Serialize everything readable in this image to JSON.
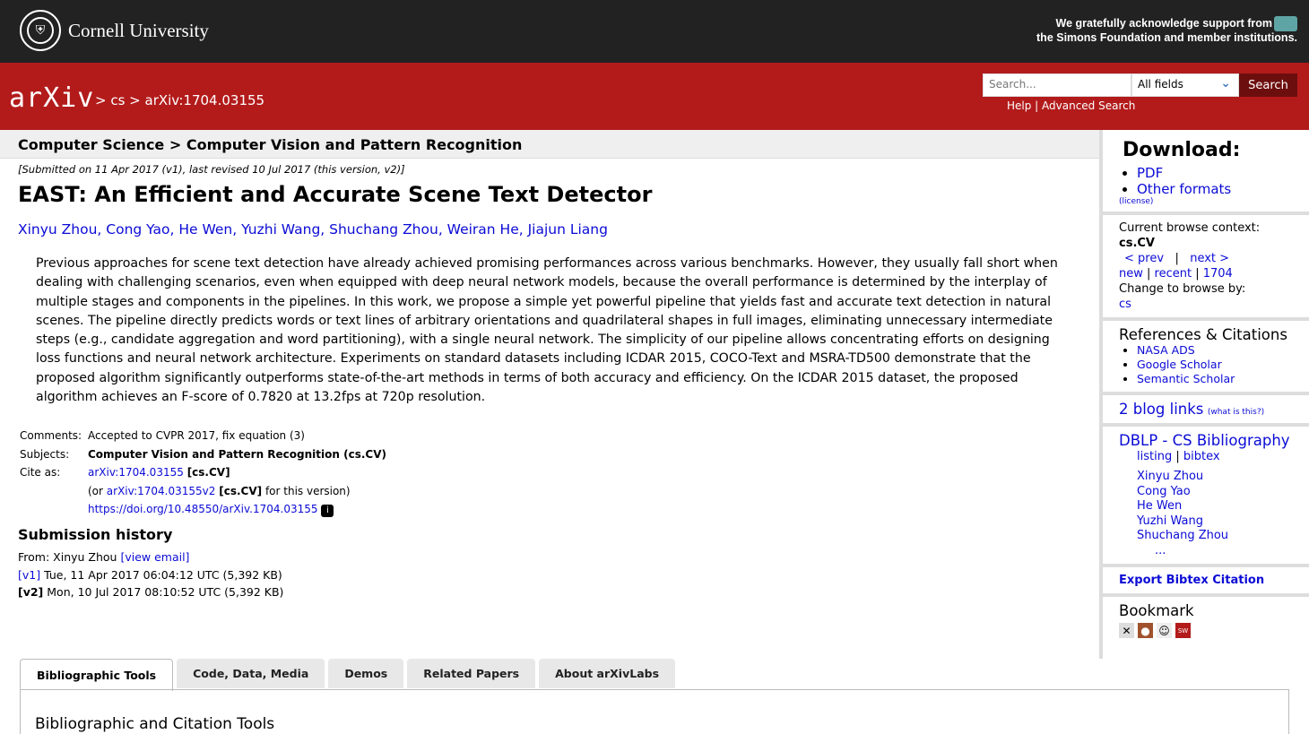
{
  "topbar": {
    "university": "Cornell University",
    "ack_line1": "We gratefully acknowledge support from",
    "ack_line2": "the Simons Foundation and member institutions."
  },
  "header": {
    "logo": "arXiv",
    "breadcrumb": "> cs > arXiv:1704.03155",
    "search_placeholder": "Search...",
    "search_field": "All fields",
    "search_button": "Search",
    "help_links": "Help | Advanced Search"
  },
  "subject_bar": "Computer Science > Computer Vision and Pattern Recognition",
  "paper": {
    "dateline": "[Submitted on 11 Apr 2017 (v1), last revised 10 Jul 2017 (this version, v2)]",
    "title": "EAST: An Efficient and Accurate Scene Text Detector",
    "authors": "Xinyu Zhou, Cong Yao, He Wen, Yuzhi Wang, Shuchang Zhou, Weiran He, Jiajun Liang",
    "abstract": "Previous approaches for scene text detection have already achieved promising performances across various benchmarks. However, they usually fall short when dealing with challenging scenarios, even when equipped with deep neural network models, because the overall performance is determined by the interplay of multiple stages and components in the pipelines. In this work, we propose a simple yet powerful pipeline that yields fast and accurate text detection in natural scenes. The pipeline directly predicts words or text lines of arbitrary orientations and quadrilateral shapes in full images, eliminating unnecessary intermediate steps (e.g., candidate aggregation and word partitioning), with a single neural network. The simplicity of our pipeline allows concentrating efforts on designing loss functions and neural network architecture. Experiments on standard datasets including ICDAR 2015, COCO-Text and MSRA-TD500 demonstrate that the proposed algorithm significantly outperforms state-of-the-art methods in terms of both accuracy and efficiency. On the ICDAR 2015 dataset, the proposed algorithm achieves an F-score of 0.7820 at 13.2fps at 720p resolution.",
    "comments_label": "Comments:",
    "comments": "Accepted to CVPR 2017, fix equation (3)",
    "subjects_label": "Subjects:",
    "subjects": "Computer Vision and Pattern Recognition (cs.CV)",
    "cite_label": "Cite as:",
    "cite_id": "arXiv:1704.03155",
    "cite_cat": "[cs.CV]",
    "cite_version_pre": "(or",
    "cite_version_id": "arXiv:1704.03155v2",
    "cite_version_cat": "[cs.CV]",
    "cite_version_post": "for this version)",
    "doi": "https://doi.org/10.48550/arXiv.1704.03155",
    "history_title": "Submission history",
    "from_label": "From: Xinyu Zhou",
    "view_email": "[view email]",
    "v1_link": "[v1]",
    "v1": "Tue, 11 Apr 2017 06:04:12 UTC (5,392 KB)",
    "v2_label": "[v2]",
    "v2": "Mon, 10 Jul 2017 08:10:52 UTC (5,392 KB)"
  },
  "sidebar": {
    "download_title": "Download:",
    "pdf": "PDF",
    "other_formats": "Other formats",
    "license": "(license)",
    "browse_context": "Current browse context:",
    "context": "cs.CV",
    "prev": "< prev",
    "sep": "|",
    "next": "next >",
    "new": "new",
    "recent": "recent",
    "month": "1704",
    "change_browse": "Change to browse by:",
    "cs": "cs",
    "refs_title": "References & Citations",
    "refs": [
      "NASA ADS",
      "Google Scholar",
      "Semantic Scholar"
    ],
    "blog_links": "2 blog links",
    "what_is": "(what is this?)",
    "dblp": "DBLP - CS Bibliography",
    "listing": "listing",
    "bibtex": "bibtex",
    "dblp_authors": [
      "Xinyu Zhou",
      "Cong Yao",
      "He Wen",
      "Yuzhi Wang",
      "Shuchang Zhou"
    ],
    "ellipsis": "...",
    "export": "Export Bibtex Citation",
    "bookmark": "Bookmark"
  },
  "tabs": [
    "Bibliographic Tools",
    "Code, Data, Media",
    "Demos",
    "Related Papers",
    "About arXivLabs"
  ],
  "tab_panel_title": "Bibliographic and Citation Tools"
}
